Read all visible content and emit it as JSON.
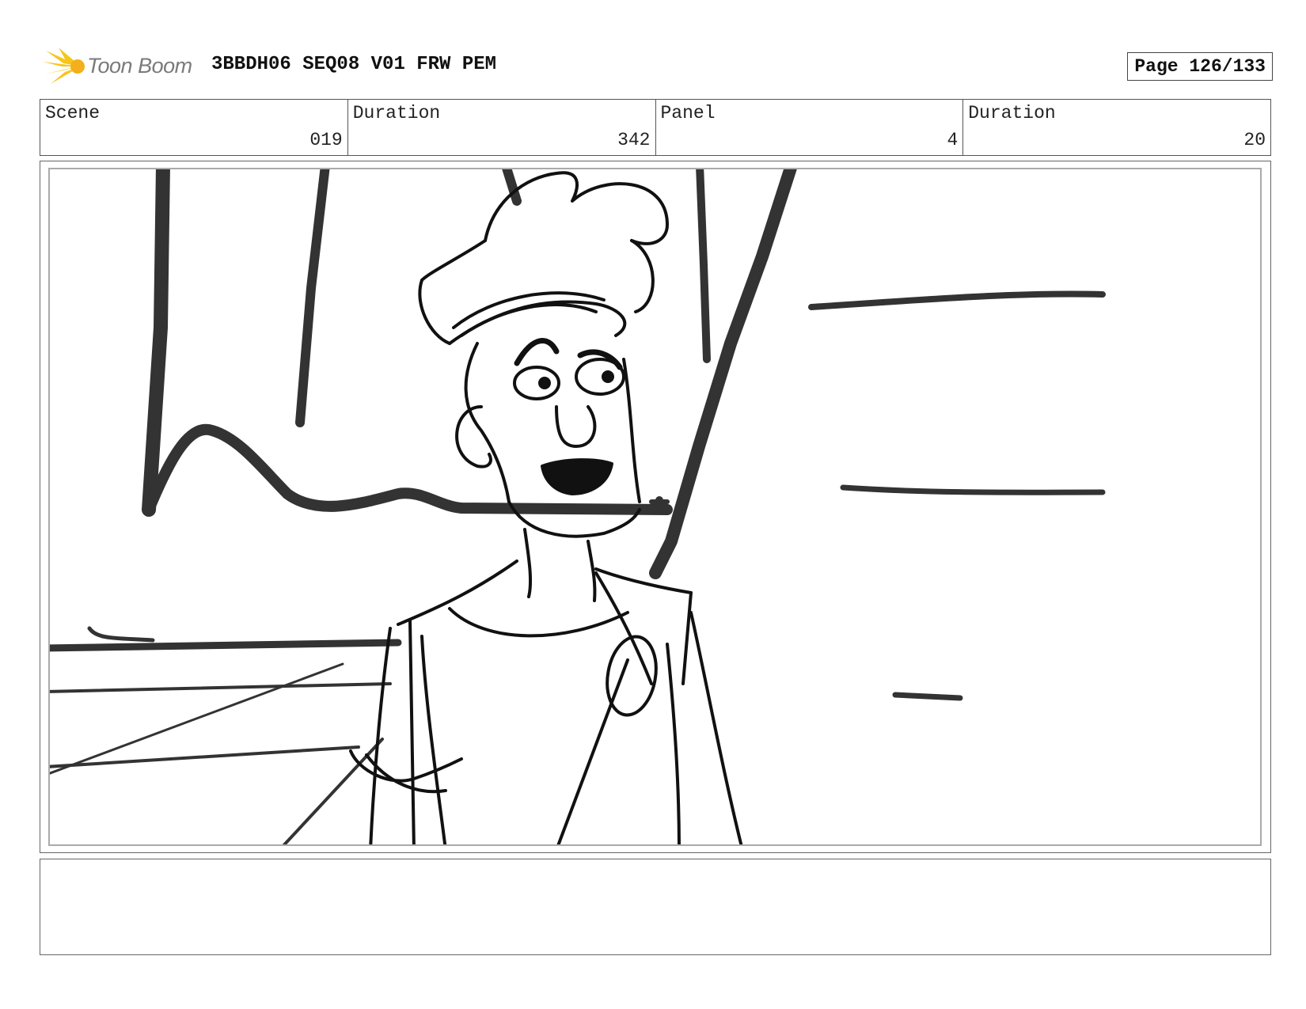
{
  "header": {
    "logo_text": "Toon Boom",
    "title": "3BBDH06 SEQ08 V01 FRW PEM",
    "page": "Page 126/133"
  },
  "info": {
    "scene_label": "Scene",
    "scene_value": "019",
    "scene_duration_label": "Duration",
    "scene_duration_value": "342",
    "panel_label": "Panel",
    "panel_value": "4",
    "panel_duration_label": "Duration",
    "panel_duration_value": "20"
  },
  "notes": {
    "text": ""
  }
}
